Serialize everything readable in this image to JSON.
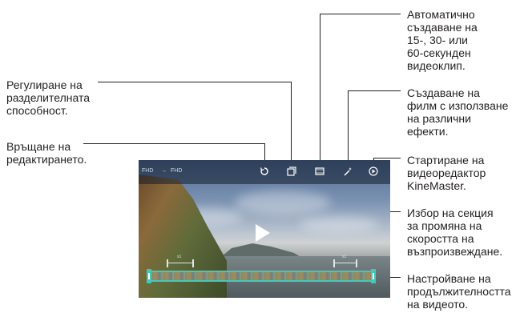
{
  "callouts": {
    "auto_clip": "Автоматично\nсъздаване на\n15-, 30- или\n60-секунден\nвидеоклип.",
    "resolution": "Регулиране на\nразделителната\nспособност.",
    "undo_edit": "Връщане на\nредактирането.",
    "movie_effects": "Създаване на\nфилм с използване\nна различни\nефекти.",
    "kinemaster": "Стартиране на\nвидеоредактор\nKineMaster.",
    "speed_section": "Избор на секция\nза промяна на\nскоростта на\nвъзпроизвеждане.",
    "duration": "Настройване на\nпродължителността\nна видеото."
  },
  "screen": {
    "topbar_left_1": "FHD",
    "topbar_arrow": "→",
    "topbar_left_2": "FHD",
    "speed_left": "x1",
    "speed_right": "x1"
  },
  "icons": {
    "undo": "undo-icon",
    "resolution": "resolution-icon",
    "auto_clip": "filmstrip-icon",
    "movie": "magic-wand-icon",
    "kinemaster": "kinemaster-icon",
    "play": "play-icon"
  },
  "colors": {
    "accent": "#48c7b7",
    "callout_text": "#231f20"
  }
}
